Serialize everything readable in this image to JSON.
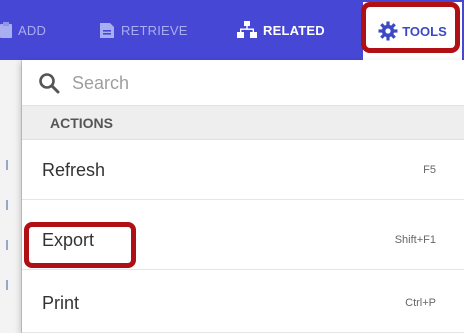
{
  "toolbar": {
    "add_label": "ADD",
    "retrieve_label": "RETRIEVE",
    "related_label": "RELATED",
    "tools_label": "TOOLS"
  },
  "menu": {
    "search_placeholder": "Search",
    "section_header": "ACTIONS",
    "items": [
      {
        "label": "Refresh",
        "shortcut": "F5"
      },
      {
        "label": "Export",
        "shortcut": "Shift+F1"
      },
      {
        "label": "Print",
        "shortcut": "Ctrl+P"
      }
    ]
  },
  "icons": {
    "add": "clipboard-icon",
    "retrieve": "document-icon",
    "related": "sitemap-icon",
    "tools": "gear-icon",
    "search": "search-icon"
  },
  "colors": {
    "toolbar_bg": "#4747d6",
    "tools_accent": "#3b49c6",
    "highlight": "#b00f14",
    "section_bg": "#eeeeee"
  }
}
